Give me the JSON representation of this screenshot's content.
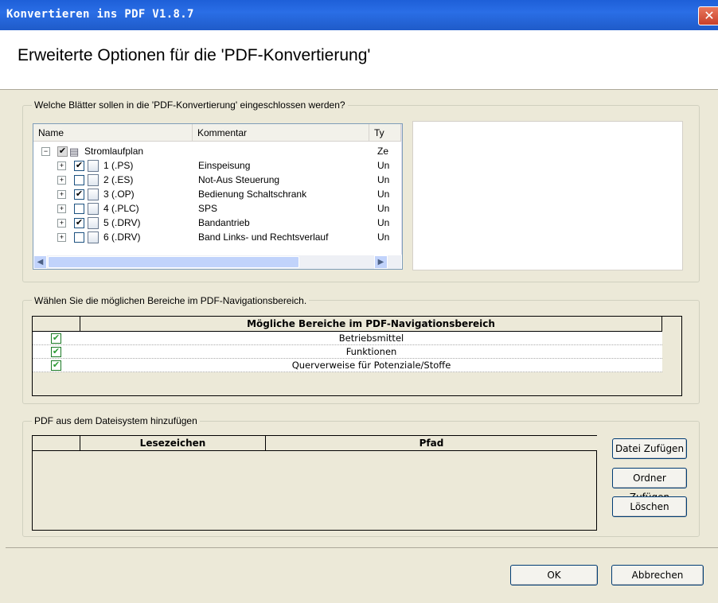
{
  "window": {
    "title": "Konvertieren ins PDF V1.8.7",
    "close_glyph": "✕"
  },
  "header": {
    "title": "Erweiterte Optionen für die 'PDF-Konvertierung'"
  },
  "sheets_group": {
    "label": "Welche Blätter sollen in die 'PDF-Konvertierung' eingeschlossen werden?",
    "columns": {
      "name": "Name",
      "comment": "Kommentar",
      "type": "Ty"
    },
    "root": {
      "label": "Stromlaufplan",
      "type": "Ze",
      "expander": "−",
      "checked": true
    },
    "rows": [
      {
        "label": "1 (.PS)",
        "comment": "Einspeisung",
        "type": "Un",
        "checked": true,
        "mark": "✔"
      },
      {
        "label": "2 (.ES)",
        "comment": "Not-Aus Steuerung",
        "type": "Un",
        "checked": false,
        "mark": ""
      },
      {
        "label": "3 (.OP)",
        "comment": "Bedienung Schaltschrank",
        "type": "Un",
        "checked": true,
        "mark": "✔"
      },
      {
        "label": "4 (.PLC)",
        "comment": "SPS",
        "type": "Un",
        "checked": false,
        "mark": ""
      },
      {
        "label": "5 (.DRV)",
        "comment": "Bandantrieb",
        "type": "Un",
        "checked": true,
        "mark": "✔"
      },
      {
        "label": "6 (.DRV)",
        "comment": "Band Links- und Rechtsverlauf",
        "type": "Un",
        "checked": false,
        "mark": ""
      }
    ],
    "expander": "+",
    "scroll_up": "▲",
    "scroll_down": "▼",
    "scroll_left": "◀",
    "scroll_right": "▶"
  },
  "nav_group": {
    "label": "Wählen Sie die möglichen Bereiche im PDF-Navigationsbereich.",
    "header": "Mögliche Bereiche im PDF-Navigationsbereich",
    "check_glyph": "✔",
    "rows": [
      {
        "label": "Betriebsmittel",
        "checked": true
      },
      {
        "label": "Funktionen",
        "checked": true
      },
      {
        "label": "Querverweise für Potenziale/Stoffe",
        "checked": true
      }
    ]
  },
  "files_group": {
    "label": "PDF aus dem Dateisystem hinzufügen",
    "columns": {
      "bookmark": "Lesezeichen",
      "path": "Pfad"
    },
    "add_file": "Datei Zufügen",
    "add_folder": "Ordner Zufügen",
    "delete": "Löschen"
  },
  "footer": {
    "ok": "OK",
    "cancel": "Abbrechen"
  },
  "colors": {
    "titlebar": "#2a6ee6",
    "dialog_bg": "#ece9d8",
    "check_green": "#2a9b33"
  }
}
